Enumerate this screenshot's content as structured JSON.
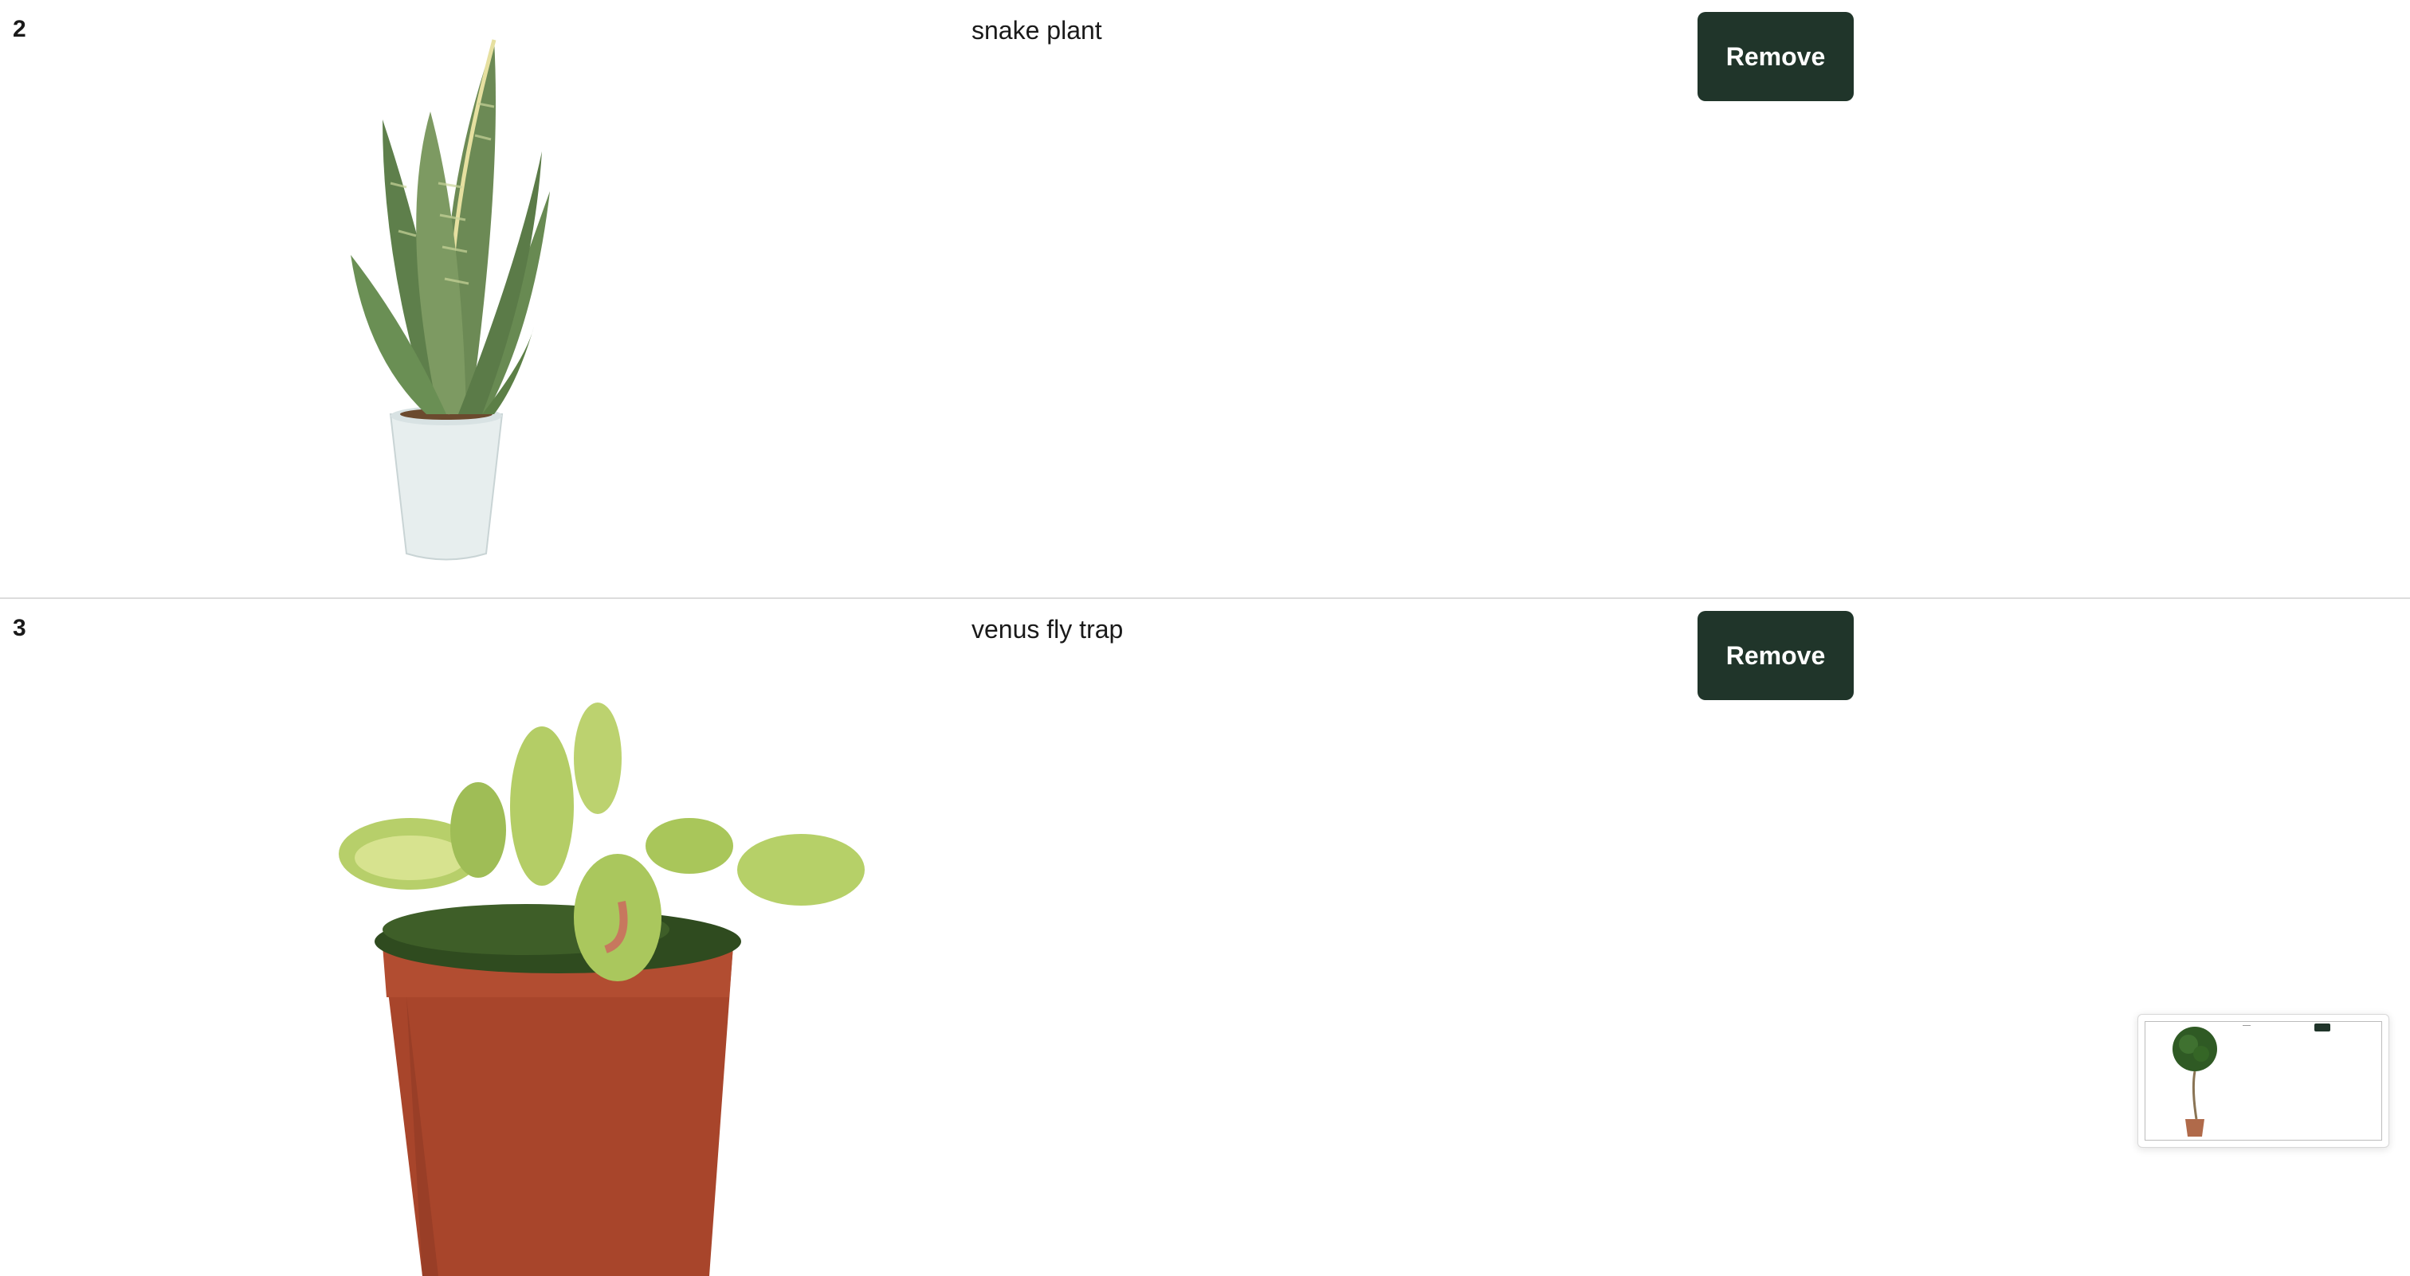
{
  "cart": {
    "items": [
      {
        "index": "2",
        "name": "snake plant",
        "remove_label": "Remove",
        "image": "snake-plant"
      },
      {
        "index": "3",
        "name": "venus fly trap",
        "remove_label": "Remove",
        "image": "venus-fly-trap"
      }
    ]
  },
  "preview": {
    "image": "topiary-tree"
  },
  "colors": {
    "button_bg": "#20352a",
    "button_text": "#ffffff",
    "divider": "#dcdcdc"
  }
}
